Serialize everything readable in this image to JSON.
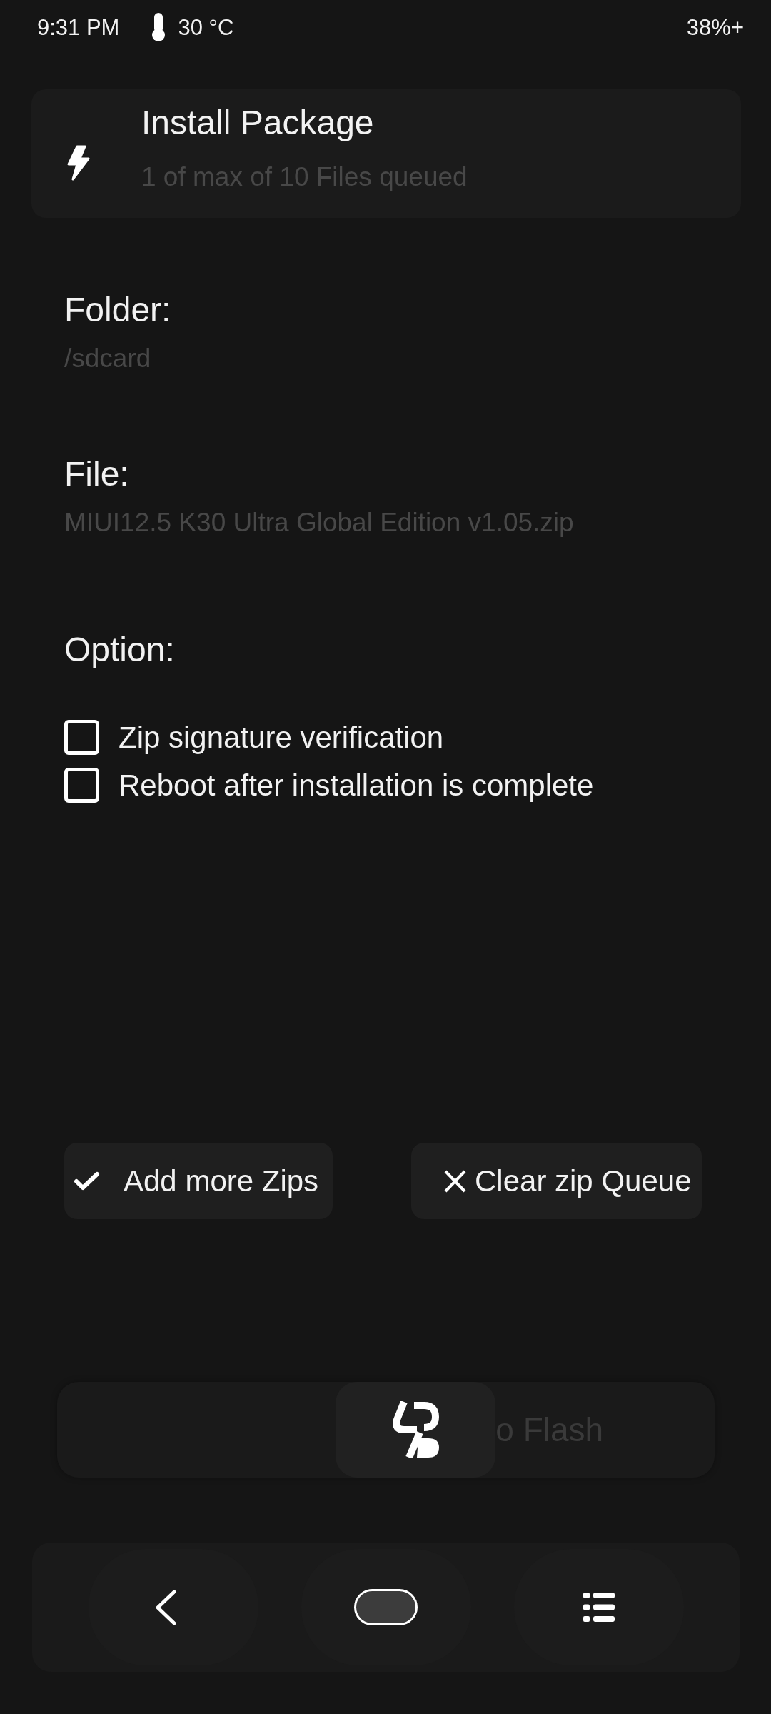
{
  "status_bar": {
    "time": "9:31 PM",
    "temperature": "30 °C",
    "battery": "38%+"
  },
  "header": {
    "title": "Install Package",
    "subtitle": "1 of max of 10 Files queued"
  },
  "fields": [
    {
      "label": "Folder:",
      "value": "/sdcard"
    },
    {
      "label": "File:",
      "value": "MIUI12.5 K30 Ultra Global Edition v1.05.zip"
    }
  ],
  "options": {
    "label": "Option:",
    "items": [
      {
        "label": "Zip signature verification",
        "checked": false
      },
      {
        "label": "Reboot after installation is complete",
        "checked": false
      }
    ]
  },
  "buttons": [
    {
      "kind": "add",
      "label": "Add more Zips"
    },
    {
      "kind": "clear",
      "label": "Clear zip Queue"
    }
  ],
  "swipe": {
    "label": "o Flash",
    "level": 0.56
  }
}
